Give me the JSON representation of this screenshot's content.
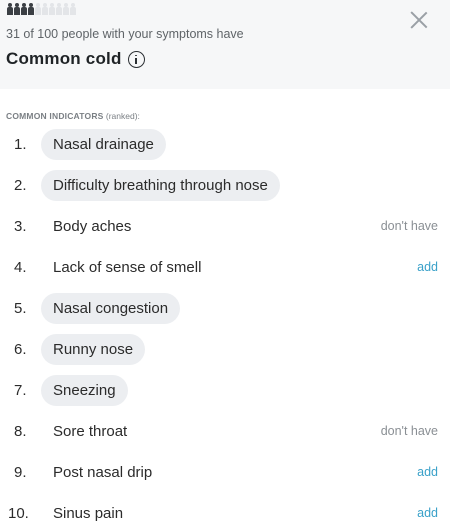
{
  "header": {
    "people_total": 10,
    "people_highlighted": 4,
    "subtitle": "31 of 100 people with your symptoms have",
    "title": "Common cold"
  },
  "section_label": {
    "strong": "COMMON INDICATORS",
    "rest": " (ranked):"
  },
  "indicators": [
    {
      "num": "1.",
      "label": "Nasal drainage",
      "matched": true,
      "action": ""
    },
    {
      "num": "2.",
      "label": "Difficulty breathing through nose",
      "matched": true,
      "action": ""
    },
    {
      "num": "3.",
      "label": "Body aches",
      "matched": false,
      "action": "don't have"
    },
    {
      "num": "4.",
      "label": "Lack of sense of smell",
      "matched": false,
      "action": "add"
    },
    {
      "num": "5.",
      "label": "Nasal congestion",
      "matched": true,
      "action": ""
    },
    {
      "num": "6.",
      "label": "Runny nose",
      "matched": true,
      "action": ""
    },
    {
      "num": "7.",
      "label": "Sneezing",
      "matched": true,
      "action": ""
    },
    {
      "num": "8.",
      "label": "Sore throat",
      "matched": false,
      "action": "don't have"
    },
    {
      "num": "9.",
      "label": "Post nasal drip",
      "matched": false,
      "action": "add"
    },
    {
      "num": "10.",
      "label": "Sinus pain",
      "matched": false,
      "action": "add"
    }
  ],
  "colors": {
    "header_bg": "#f6f7f8",
    "pill_bg": "#eceef1",
    "add_link": "#3aa1c9",
    "muted": "#8a8f94"
  },
  "icons": {
    "close": "close-icon",
    "info": "info-icon",
    "people": "person-icon"
  }
}
